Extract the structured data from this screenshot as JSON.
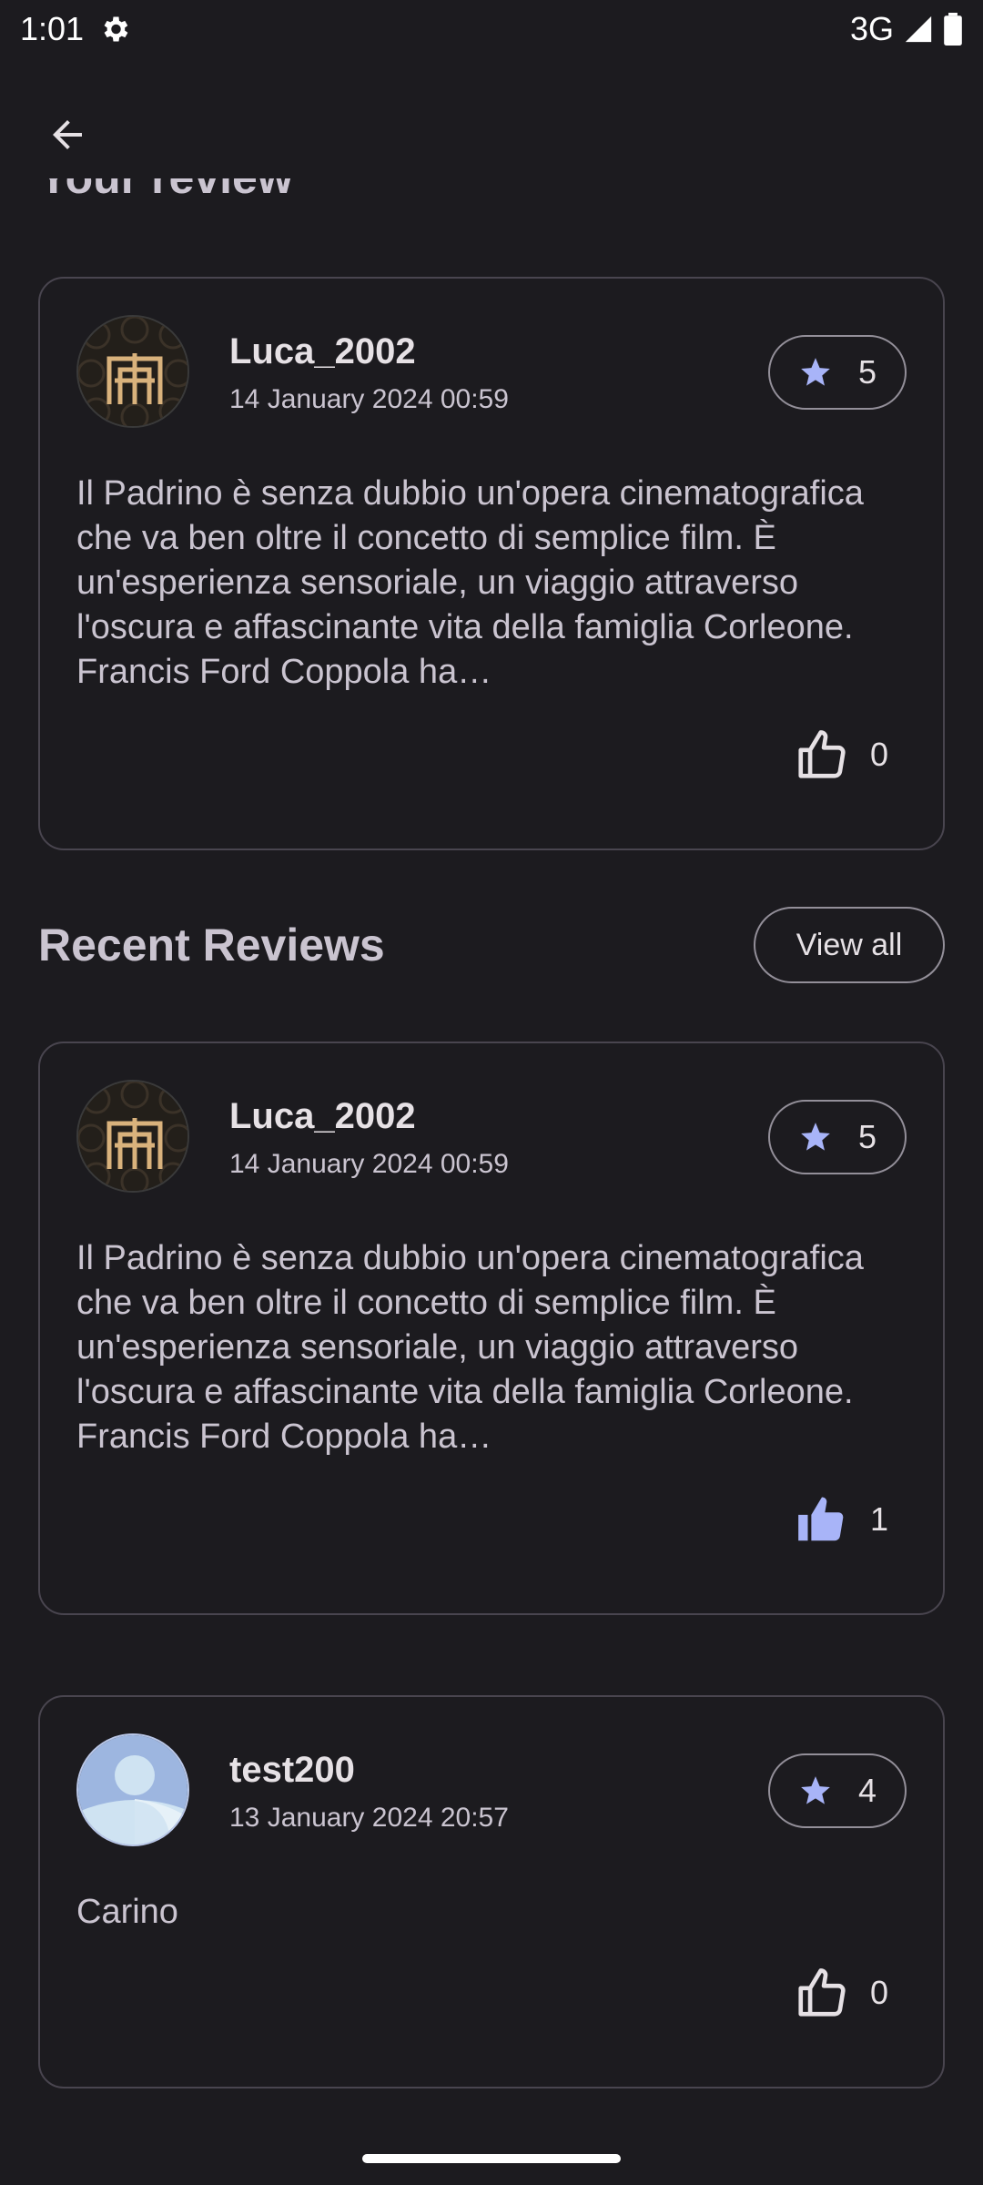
{
  "status_bar": {
    "time": "1:01",
    "network": "3G"
  },
  "your_review_title": "Your review",
  "your_review": {
    "username": "Luca_2002",
    "date": "14 January 2024 00:59",
    "rating": "5",
    "text": "Il Padrino è senza dubbio un'opera cinematografica che va ben oltre il concetto di semplice film. È un'esperienza sensoriale, un viaggio attraverso l'oscura e affascinante vita della famiglia Corleone. Francis Ford Coppola ha…",
    "likes": "0",
    "liked": false
  },
  "recent_reviews": {
    "title": "Recent Reviews",
    "view_all_label": "View all",
    "items": [
      {
        "username": "Luca_2002",
        "date": "14 January 2024 00:59",
        "rating": "5",
        "text": "Il Padrino è senza dubbio un'opera cinematografica che va ben oltre il concetto di semplice film. È un'esperienza sensoriale, un viaggio attraverso l'oscura e affascinante vita della famiglia Corleone. Francis Ford Coppola ha…",
        "likes": "1",
        "liked": true
      },
      {
        "username": "test200",
        "date": "13 January 2024 20:57",
        "rating": "4",
        "text": "Carino",
        "likes": "0",
        "liked": false
      }
    ]
  },
  "colors": {
    "background": "#1c1b1f",
    "accent": "#a8b4f8",
    "outline": "#49454f"
  }
}
